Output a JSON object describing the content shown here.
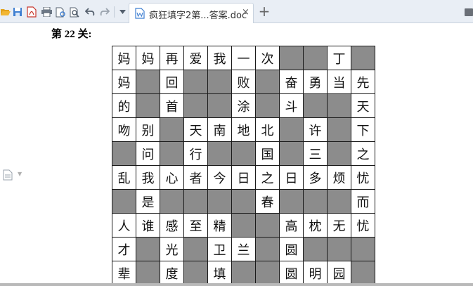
{
  "toolbar": {
    "icons": [
      "folder-open-icon",
      "save-icon",
      "pdf-export-icon",
      "print-icon",
      "print-preview-icon",
      "find-icon",
      "undo-icon",
      "redo-icon",
      "dropdown-icon"
    ]
  },
  "tab": {
    "title": "疯狂填字2第...答案.doc",
    "close": "×",
    "new": "+"
  },
  "document": {
    "heading": "第 22 关:",
    "grid": [
      [
        "妈",
        "妈",
        "再",
        "爱",
        "我",
        "一",
        "次",
        "",
        "",
        "丁",
        ""
      ],
      [
        "妈",
        "",
        "回",
        "",
        "",
        "败",
        "",
        "奋",
        "勇",
        "当",
        "先"
      ],
      [
        "的",
        "",
        "首",
        "",
        "",
        "涂",
        "",
        "斗",
        "",
        "",
        "天"
      ],
      [
        "吻",
        "别",
        "",
        "天",
        "南",
        "地",
        "北",
        "",
        "许",
        "",
        "下"
      ],
      [
        "",
        "问",
        "",
        "行",
        "",
        "",
        "国",
        "",
        "三",
        "",
        "之"
      ],
      [
        "乱",
        "我",
        "心",
        "者",
        "今",
        "日",
        "之",
        "日",
        "多",
        "烦",
        "忧"
      ],
      [
        "",
        "是",
        "",
        "",
        "",
        "",
        "春",
        "",
        "",
        "",
        "而"
      ],
      [
        "人",
        "谁",
        "感",
        "至",
        "精",
        "",
        "",
        "高",
        "枕",
        "无",
        "忧"
      ],
      [
        "才",
        "",
        "光",
        "",
        "卫",
        "兰",
        "",
        "圆",
        "",
        "",
        ""
      ],
      [
        "辈",
        "",
        "度",
        "",
        "填",
        "",
        "",
        "圆",
        "明",
        "园",
        ""
      ]
    ],
    "shaded": [
      [
        0,
        0,
        0,
        0,
        0,
        0,
        0,
        1,
        1,
        0,
        1
      ],
      [
        0,
        1,
        0,
        1,
        1,
        0,
        1,
        0,
        0,
        0,
        0
      ],
      [
        0,
        1,
        0,
        1,
        1,
        0,
        1,
        0,
        1,
        1,
        0
      ],
      [
        0,
        0,
        1,
        0,
        0,
        0,
        0,
        1,
        0,
        1,
        0
      ],
      [
        1,
        0,
        1,
        0,
        1,
        1,
        0,
        1,
        0,
        1,
        0
      ],
      [
        0,
        0,
        0,
        0,
        0,
        0,
        0,
        0,
        0,
        0,
        0
      ],
      [
        1,
        0,
        1,
        1,
        1,
        1,
        0,
        1,
        1,
        1,
        0
      ],
      [
        0,
        0,
        0,
        0,
        0,
        1,
        1,
        0,
        0,
        0,
        0
      ],
      [
        0,
        1,
        0,
        1,
        0,
        0,
        1,
        0,
        1,
        1,
        1
      ],
      [
        0,
        1,
        0,
        1,
        0,
        1,
        1,
        0,
        0,
        0,
        1
      ]
    ]
  },
  "colors": {
    "shaded_cell": "#8c8c8c",
    "grid_line": "#1a1a1a",
    "toolbar_bg": "#e9eef5"
  }
}
